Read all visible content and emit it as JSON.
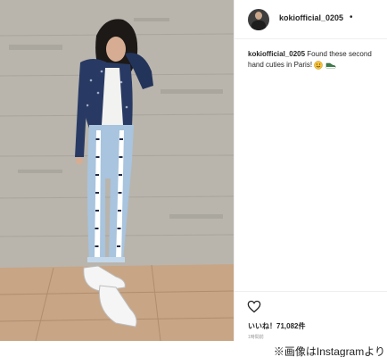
{
  "post": {
    "username": "kokiofficial_0205",
    "more_dot": "•",
    "caption_text": "Found these second hand cuties in Paris!",
    "caption_emojis": [
      "smiling-face-icon",
      "sneaker-icon"
    ],
    "like_icon": "heart-outline-icon",
    "likes_label": "いいね！71,082件",
    "timestamp": "1時間前"
  },
  "footer": {
    "credit": "※画像はInstagramより"
  },
  "photo": {
    "alt_description_icon": "photo-woman-wall"
  }
}
